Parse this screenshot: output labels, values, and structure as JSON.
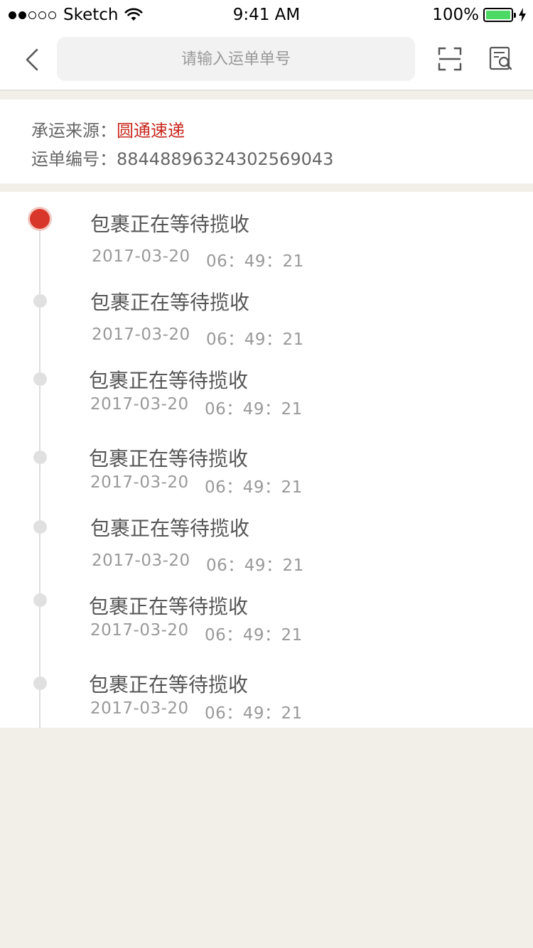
{
  "status_bar": {
    "carrier": "Sketch",
    "time": "9:41 AM",
    "battery": "100%"
  },
  "nav": {
    "search_placeholder": "请输入运单单号"
  },
  "info": {
    "carrier_label": "承运来源：",
    "carrier_name": "圆通速递",
    "waybill_label": "运单编号：",
    "waybill_number": "88448896324302569043"
  },
  "timeline": [
    {
      "title": "包裹正在等待揽收",
      "date": "2017-03-20",
      "time": "06：49：21"
    },
    {
      "title": "包裹正在等待揽收",
      "date": "2017-03-20",
      "time": "06：49：21"
    },
    {
      "title": "包裹正在等待揽收",
      "date": "2017-03-20",
      "time": "06：49：21"
    },
    {
      "title": "包裹正在等待揽收",
      "date": "2017-03-20",
      "time": "06：49：21"
    },
    {
      "title": "包裹正在等待揽收",
      "date": "2017-03-20",
      "time": "06：49：21"
    },
    {
      "title": "包裹正在等待揽收",
      "date": "2017-03-20",
      "time": "06：49：21"
    },
    {
      "title": "包裹正在等待揽收",
      "date": "2017-03-20",
      "time": "06：49：21"
    }
  ],
  "colors": {
    "accent": "#d8362a",
    "background": "#f2efe9",
    "battery": "#4cd964"
  }
}
